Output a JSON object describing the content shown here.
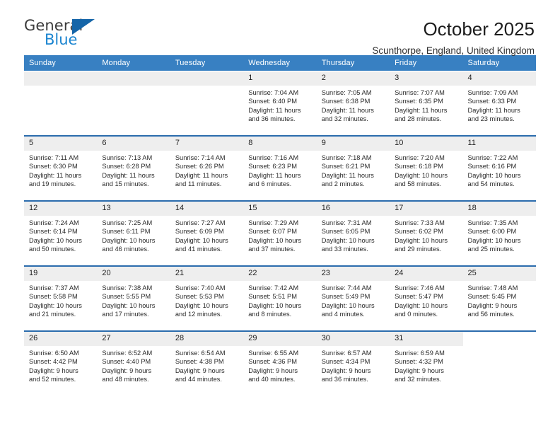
{
  "brand": {
    "name_part1": "General",
    "name_part2": "Blue",
    "triangle_icon": "blue-triangle-icon"
  },
  "header": {
    "title": "October 2025",
    "subtitle": "Scunthorpe, England, United Kingdom"
  },
  "colors": {
    "header_blue": "#3880c2",
    "row_divider_blue": "#2b6cad",
    "daynum_band": "#eeeeee",
    "brand_blue": "#1a84d0"
  },
  "weekday_headers": [
    "Sunday",
    "Monday",
    "Tuesday",
    "Wednesday",
    "Thursday",
    "Friday",
    "Saturday"
  ],
  "labels": {
    "sunrise_prefix": "Sunrise:",
    "sunset_prefix": "Sunset:",
    "daylight_prefix": "Daylight:"
  },
  "weeks": [
    [
      {
        "day": "",
        "sunrise": "",
        "sunset": "",
        "daylight_line1": "",
        "daylight_line2": "",
        "empty": true
      },
      {
        "day": "",
        "sunrise": "",
        "sunset": "",
        "daylight_line1": "",
        "daylight_line2": "",
        "empty": true
      },
      {
        "day": "",
        "sunrise": "",
        "sunset": "",
        "daylight_line1": "",
        "daylight_line2": "",
        "empty": true
      },
      {
        "day": "1",
        "sunrise": "Sunrise: 7:04 AM",
        "sunset": "Sunset: 6:40 PM",
        "daylight_line1": "Daylight: 11 hours",
        "daylight_line2": "and 36 minutes."
      },
      {
        "day": "2",
        "sunrise": "Sunrise: 7:05 AM",
        "sunset": "Sunset: 6:38 PM",
        "daylight_line1": "Daylight: 11 hours",
        "daylight_line2": "and 32 minutes."
      },
      {
        "day": "3",
        "sunrise": "Sunrise: 7:07 AM",
        "sunset": "Sunset: 6:35 PM",
        "daylight_line1": "Daylight: 11 hours",
        "daylight_line2": "and 28 minutes."
      },
      {
        "day": "4",
        "sunrise": "Sunrise: 7:09 AM",
        "sunset": "Sunset: 6:33 PM",
        "daylight_line1": "Daylight: 11 hours",
        "daylight_line2": "and 23 minutes."
      }
    ],
    [
      {
        "day": "5",
        "sunrise": "Sunrise: 7:11 AM",
        "sunset": "Sunset: 6:30 PM",
        "daylight_line1": "Daylight: 11 hours",
        "daylight_line2": "and 19 minutes."
      },
      {
        "day": "6",
        "sunrise": "Sunrise: 7:13 AM",
        "sunset": "Sunset: 6:28 PM",
        "daylight_line1": "Daylight: 11 hours",
        "daylight_line2": "and 15 minutes."
      },
      {
        "day": "7",
        "sunrise": "Sunrise: 7:14 AM",
        "sunset": "Sunset: 6:26 PM",
        "daylight_line1": "Daylight: 11 hours",
        "daylight_line2": "and 11 minutes."
      },
      {
        "day": "8",
        "sunrise": "Sunrise: 7:16 AM",
        "sunset": "Sunset: 6:23 PM",
        "daylight_line1": "Daylight: 11 hours",
        "daylight_line2": "and 6 minutes."
      },
      {
        "day": "9",
        "sunrise": "Sunrise: 7:18 AM",
        "sunset": "Sunset: 6:21 PM",
        "daylight_line1": "Daylight: 11 hours",
        "daylight_line2": "and 2 minutes."
      },
      {
        "day": "10",
        "sunrise": "Sunrise: 7:20 AM",
        "sunset": "Sunset: 6:18 PM",
        "daylight_line1": "Daylight: 10 hours",
        "daylight_line2": "and 58 minutes."
      },
      {
        "day": "11",
        "sunrise": "Sunrise: 7:22 AM",
        "sunset": "Sunset: 6:16 PM",
        "daylight_line1": "Daylight: 10 hours",
        "daylight_line2": "and 54 minutes."
      }
    ],
    [
      {
        "day": "12",
        "sunrise": "Sunrise: 7:24 AM",
        "sunset": "Sunset: 6:14 PM",
        "daylight_line1": "Daylight: 10 hours",
        "daylight_line2": "and 50 minutes."
      },
      {
        "day": "13",
        "sunrise": "Sunrise: 7:25 AM",
        "sunset": "Sunset: 6:11 PM",
        "daylight_line1": "Daylight: 10 hours",
        "daylight_line2": "and 46 minutes."
      },
      {
        "day": "14",
        "sunrise": "Sunrise: 7:27 AM",
        "sunset": "Sunset: 6:09 PM",
        "daylight_line1": "Daylight: 10 hours",
        "daylight_line2": "and 41 minutes."
      },
      {
        "day": "15",
        "sunrise": "Sunrise: 7:29 AM",
        "sunset": "Sunset: 6:07 PM",
        "daylight_line1": "Daylight: 10 hours",
        "daylight_line2": "and 37 minutes."
      },
      {
        "day": "16",
        "sunrise": "Sunrise: 7:31 AM",
        "sunset": "Sunset: 6:05 PM",
        "daylight_line1": "Daylight: 10 hours",
        "daylight_line2": "and 33 minutes."
      },
      {
        "day": "17",
        "sunrise": "Sunrise: 7:33 AM",
        "sunset": "Sunset: 6:02 PM",
        "daylight_line1": "Daylight: 10 hours",
        "daylight_line2": "and 29 minutes."
      },
      {
        "day": "18",
        "sunrise": "Sunrise: 7:35 AM",
        "sunset": "Sunset: 6:00 PM",
        "daylight_line1": "Daylight: 10 hours",
        "daylight_line2": "and 25 minutes."
      }
    ],
    [
      {
        "day": "19",
        "sunrise": "Sunrise: 7:37 AM",
        "sunset": "Sunset: 5:58 PM",
        "daylight_line1": "Daylight: 10 hours",
        "daylight_line2": "and 21 minutes."
      },
      {
        "day": "20",
        "sunrise": "Sunrise: 7:38 AM",
        "sunset": "Sunset: 5:55 PM",
        "daylight_line1": "Daylight: 10 hours",
        "daylight_line2": "and 17 minutes."
      },
      {
        "day": "21",
        "sunrise": "Sunrise: 7:40 AM",
        "sunset": "Sunset: 5:53 PM",
        "daylight_line1": "Daylight: 10 hours",
        "daylight_line2": "and 12 minutes."
      },
      {
        "day": "22",
        "sunrise": "Sunrise: 7:42 AM",
        "sunset": "Sunset: 5:51 PM",
        "daylight_line1": "Daylight: 10 hours",
        "daylight_line2": "and 8 minutes."
      },
      {
        "day": "23",
        "sunrise": "Sunrise: 7:44 AM",
        "sunset": "Sunset: 5:49 PM",
        "daylight_line1": "Daylight: 10 hours",
        "daylight_line2": "and 4 minutes."
      },
      {
        "day": "24",
        "sunrise": "Sunrise: 7:46 AM",
        "sunset": "Sunset: 5:47 PM",
        "daylight_line1": "Daylight: 10 hours",
        "daylight_line2": "and 0 minutes."
      },
      {
        "day": "25",
        "sunrise": "Sunrise: 7:48 AM",
        "sunset": "Sunset: 5:45 PM",
        "daylight_line1": "Daylight: 9 hours",
        "daylight_line2": "and 56 minutes."
      }
    ],
    [
      {
        "day": "26",
        "sunrise": "Sunrise: 6:50 AM",
        "sunset": "Sunset: 4:42 PM",
        "daylight_line1": "Daylight: 9 hours",
        "daylight_line2": "and 52 minutes."
      },
      {
        "day": "27",
        "sunrise": "Sunrise: 6:52 AM",
        "sunset": "Sunset: 4:40 PM",
        "daylight_line1": "Daylight: 9 hours",
        "daylight_line2": "and 48 minutes."
      },
      {
        "day": "28",
        "sunrise": "Sunrise: 6:54 AM",
        "sunset": "Sunset: 4:38 PM",
        "daylight_line1": "Daylight: 9 hours",
        "daylight_line2": "and 44 minutes."
      },
      {
        "day": "29",
        "sunrise": "Sunrise: 6:55 AM",
        "sunset": "Sunset: 4:36 PM",
        "daylight_line1": "Daylight: 9 hours",
        "daylight_line2": "and 40 minutes."
      },
      {
        "day": "30",
        "sunrise": "Sunrise: 6:57 AM",
        "sunset": "Sunset: 4:34 PM",
        "daylight_line1": "Daylight: 9 hours",
        "daylight_line2": "and 36 minutes."
      },
      {
        "day": "31",
        "sunrise": "Sunrise: 6:59 AM",
        "sunset": "Sunset: 4:32 PM",
        "daylight_line1": "Daylight: 9 hours",
        "daylight_line2": "and 32 minutes."
      },
      {
        "day": "",
        "sunrise": "",
        "sunset": "",
        "daylight_line1": "",
        "daylight_line2": "",
        "blank": true
      }
    ]
  ]
}
